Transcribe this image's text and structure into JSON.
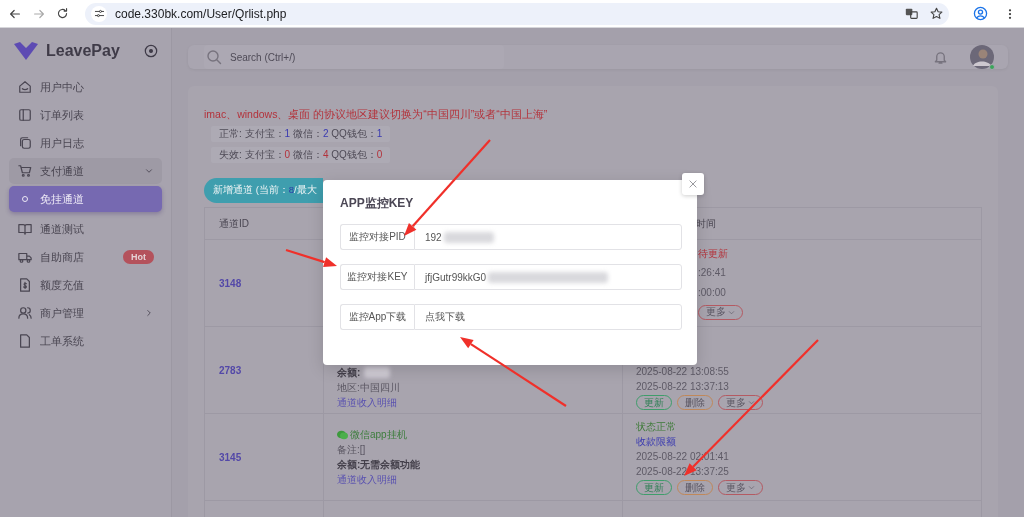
{
  "browser": {
    "url": "code.330bk.com/User/Qrlist.php"
  },
  "sidebar": {
    "brand": "LeavePay",
    "items": [
      {
        "label": "用户中心",
        "selected": false
      },
      {
        "label": "订单列表",
        "selected": false
      },
      {
        "label": "用户日志",
        "selected": false
      },
      {
        "label": "支付通道",
        "selected": false,
        "expanded": true,
        "children": [
          {
            "label": "免挂通道",
            "selected": true
          }
        ]
      },
      {
        "label": "通道测试",
        "selected": false
      },
      {
        "label": "自助商店",
        "selected": false,
        "badge": "Hot"
      },
      {
        "label": "额度充值",
        "selected": false
      },
      {
        "label": "商户管理",
        "selected": false,
        "expanded": false
      },
      {
        "label": "工单系统",
        "selected": false
      }
    ]
  },
  "header": {
    "search_placeholder": "Search (Ctrl+/)"
  },
  "notice": "imac、windows、桌面 的协议地区建议切换为“中国四川”或者“中国上海”",
  "summaries": [
    {
      "kind": "normal",
      "label": "正常:",
      "counts": [
        {
          "name": "支付宝：",
          "value": "1"
        },
        {
          "name": "微信：",
          "value": "2"
        },
        {
          "name": "QQ钱包：",
          "value": "1"
        }
      ]
    },
    {
      "kind": "failed",
      "label": "失效:",
      "counts": [
        {
          "name": "支付宝：",
          "value": "0"
        },
        {
          "name": "微信：",
          "value": "4"
        },
        {
          "name": "QQ钱包：",
          "value": "0"
        }
      ]
    }
  ],
  "add_button": {
    "label": "新增通道 (当前：",
    "count": "8",
    "suffix": "/最大"
  },
  "table": {
    "columns": [
      "通道ID",
      "时间"
    ],
    "rows": [
      {
        "id": "3148",
        "details": [],
        "status": [
          {
            "kind": "alert",
            "text": "待更新"
          },
          {
            "kind": "time",
            "text": ":26:41"
          },
          {
            "kind": "time",
            "text": ":00:00"
          }
        ],
        "actions": [
          {
            "kind": "more",
            "label": "更多"
          }
        ]
      },
      {
        "id": "2783",
        "details": [
          {
            "kind": "balance",
            "text": "余额:",
            "redacted": true
          },
          {
            "kind": "plain",
            "text": "地区:中国四川"
          },
          {
            "kind": "link",
            "text": "通道收入明细"
          }
        ],
        "status": [
          {
            "kind": "time",
            "text": "2025-08-22 13:08:55"
          },
          {
            "kind": "time",
            "text": "2025-08-22 13:37:13"
          }
        ],
        "actions": [
          {
            "kind": "update",
            "label": "更新"
          },
          {
            "kind": "delete",
            "label": "删除"
          },
          {
            "kind": "more",
            "label": "更多"
          }
        ]
      },
      {
        "id": "3145",
        "details": [
          {
            "kind": "channel",
            "text": "微信app挂机"
          },
          {
            "kind": "plain",
            "text": "备注:[]"
          },
          {
            "kind": "balance",
            "text": "余额:无需余额功能",
            "redacted": false
          },
          {
            "kind": "link",
            "text": "通道收入明细"
          }
        ],
        "status": [
          {
            "kind": "ok",
            "text": "状态正常"
          },
          {
            "kind": "limit",
            "text": "收款限额"
          },
          {
            "kind": "time",
            "text": "2025-08-22 02:01:41"
          },
          {
            "kind": "time",
            "text": "2025-08-22 13:37:25"
          }
        ],
        "actions": [
          {
            "kind": "update",
            "label": "更新"
          },
          {
            "kind": "delete",
            "label": "删除"
          },
          {
            "kind": "more",
            "label": "更多"
          }
        ]
      }
    ]
  },
  "modal": {
    "title": "APP监控KEY",
    "fields": [
      {
        "label": "监控对接PID",
        "value": "192",
        "redacted": true
      },
      {
        "label": "监控对接KEY",
        "value": "jfjGutr99kkG0",
        "redacted": true
      },
      {
        "label": "监控App下载",
        "value": "点我下载",
        "redacted": false
      }
    ]
  }
}
